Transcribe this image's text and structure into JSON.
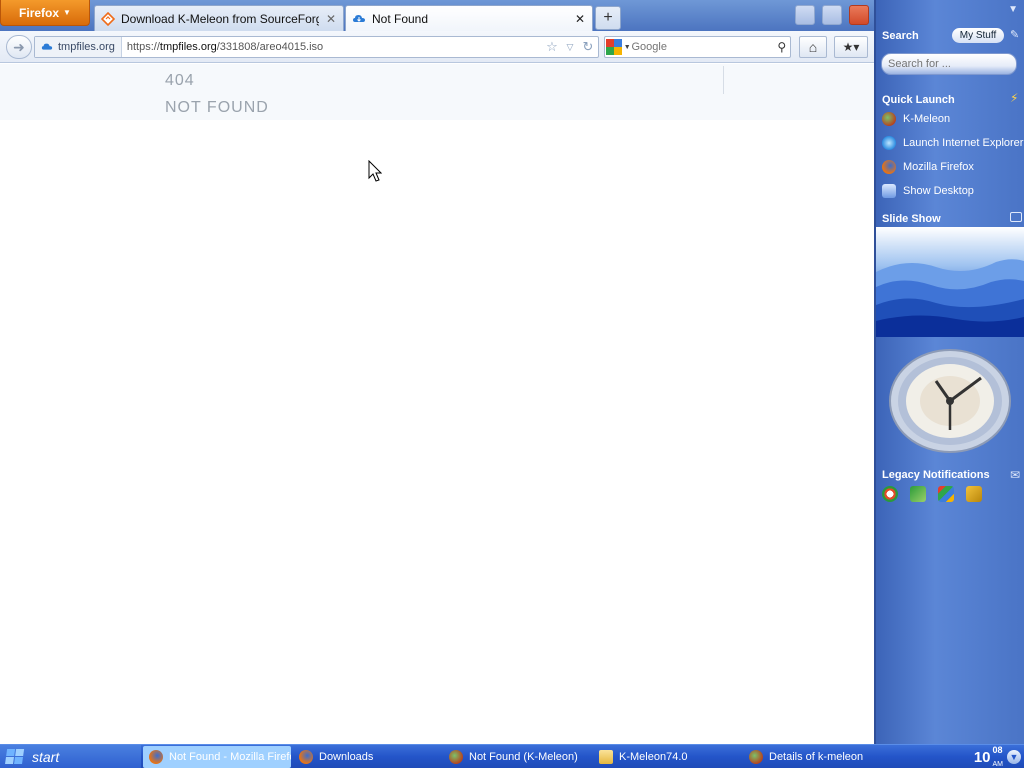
{
  "browser": {
    "menu_button": "Firefox",
    "tabs": [
      {
        "label": "Download K-Meleon from SourceForge.net",
        "active": false
      },
      {
        "label": "Not Found",
        "active": true
      }
    ],
    "new_tab": "+",
    "identity_label": "tmpfiles.org",
    "url_prefix": "https://",
    "url_domain": "tmpfiles.org",
    "url_path": "/331808/areo4015.iso",
    "search_placeholder": "Google"
  },
  "page": {
    "error_code": "404",
    "error_text": "NOT FOUND"
  },
  "sidebar": {
    "search_title": "Search",
    "my_stuff": "My Stuff",
    "search_placeholder": "Search for ...",
    "quick_launch_title": "Quick Launch",
    "quick_launch": [
      {
        "label": "K-Meleon",
        "icon": "kmeleon-icon"
      },
      {
        "label": "Launch Internet Explorer Browser",
        "icon": "ie-icon"
      },
      {
        "label": "Mozilla Firefox",
        "icon": "firefox-icon"
      },
      {
        "label": "Show Desktop",
        "icon": "desktop-icon"
      }
    ],
    "slideshow_title": "Slide Show",
    "legacy_title": "Legacy Notifications"
  },
  "taskbar": {
    "start": "start",
    "tasks": [
      {
        "label": "Not Found - Mozilla Firefox",
        "active": true
      },
      {
        "label": "Downloads",
        "active": false
      },
      {
        "label": "Not Found (K-Meleon)",
        "active": false
      },
      {
        "label": "K-Meleon74.0",
        "active": false
      },
      {
        "label": "Details of k-meleon",
        "active": false
      }
    ],
    "time": "10",
    "time_sup": "08",
    "ampm": "AM"
  },
  "colors": {
    "accent": "#2455c9",
    "firefox_orange": "#e07a14",
    "sidebar": "#4a74c6"
  }
}
